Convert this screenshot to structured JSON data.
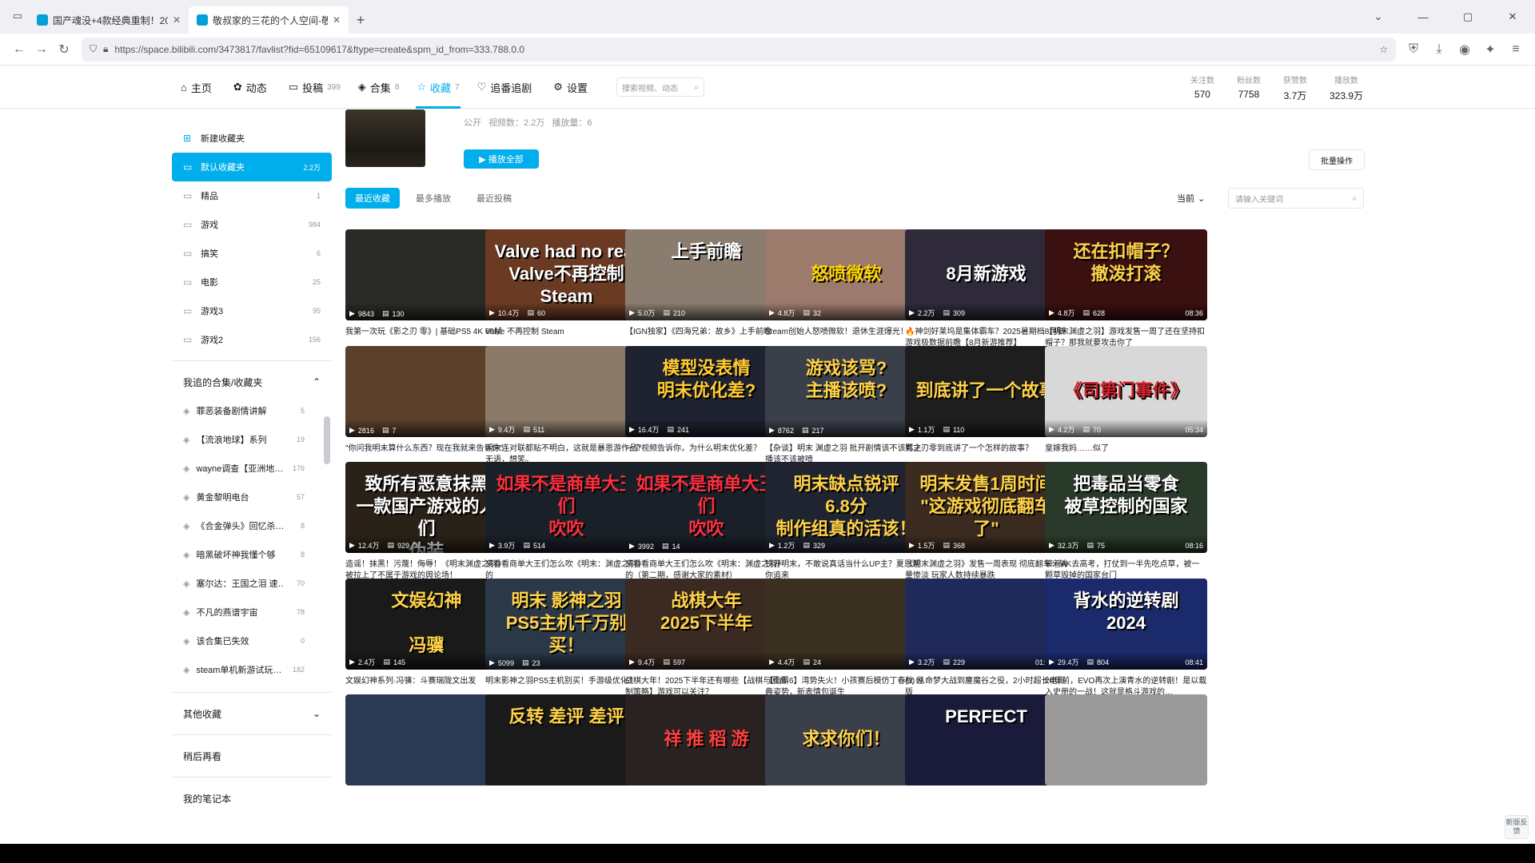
{
  "browser": {
    "tabs": [
      {
        "title": "国产魂没+4款经典重制！2025"
      },
      {
        "title": "敬叔家的三花的个人空间-敬叔"
      }
    ],
    "url": "https://space.bilibili.com/3473817/favlist?fid=65109617&ftype=create&spm_id_from=333.788.0.0"
  },
  "nav": {
    "items": [
      {
        "icon": "⌂",
        "label": "主页",
        "count": ""
      },
      {
        "icon": "✿",
        "label": "动态",
        "count": ""
      },
      {
        "icon": "▭",
        "label": "投稿",
        "count": "399"
      },
      {
        "icon": "◈",
        "label": "合集",
        "count": "8"
      },
      {
        "icon": "☆",
        "label": "收藏",
        "count": "7"
      },
      {
        "icon": "♡",
        "label": "追番追剧",
        "count": ""
      },
      {
        "icon": "⚙",
        "label": "设置",
        "count": ""
      }
    ],
    "search_placeholder": "搜索视频、动态",
    "stats": [
      {
        "label": "关注数",
        "value": "570"
      },
      {
        "label": "粉丝数",
        "value": "7758"
      },
      {
        "label": "获赞数",
        "value": "3.7万"
      },
      {
        "label": "播放数",
        "value": "323.9万"
      }
    ]
  },
  "sidebar": {
    "new_folder": "新建收藏夹",
    "folders": [
      {
        "label": "默认收藏夹",
        "count": "2.2万"
      },
      {
        "label": "精品",
        "count": "1"
      },
      {
        "label": "游戏",
        "count": "984"
      },
      {
        "label": "搞笑",
        "count": "6"
      },
      {
        "label": "电影",
        "count": "25"
      },
      {
        "label": "游戏3",
        "count": "95"
      },
      {
        "label": "游戏2",
        "count": "156"
      }
    ],
    "followed_head": "我追的合集/收藏夹",
    "followed": [
      {
        "label": "罪恶装备剧情讲解",
        "count": "5"
      },
      {
        "label": "【流浪地球】系列",
        "count": "19"
      },
      {
        "label": "wayne调查【亚洲地…",
        "count": "176"
      },
      {
        "label": "黄金黎明电台",
        "count": "57"
      },
      {
        "label": "《合金弹头》回忆杀…",
        "count": "8"
      },
      {
        "label": "暗黑破坏神我懂个够",
        "count": "8"
      },
      {
        "label": "塞尔达：王国之泪 速…",
        "count": "70"
      },
      {
        "label": "不凡的燕谱宇宙",
        "count": "78"
      },
      {
        "label": "该合集已失效",
        "count": "0"
      },
      {
        "label": "steam单机新游试玩…",
        "count": "182"
      }
    ],
    "other": "其他收藏",
    "later": "稍后再看",
    "notes": "我的笔记本"
  },
  "folder": {
    "title_partial": "默认收藏夹",
    "meta": [
      "公开",
      "视频数：2.2万",
      "播放量：6"
    ],
    "play_all": "▶ 播放全部",
    "batch": "批量操作",
    "sorts": [
      "最近收藏",
      "最多播放",
      "最近投稿"
    ],
    "scope": "当前",
    "search_placeholder": "请输入关键词"
  },
  "videos": [
    {
      "title": "我第一次玩《影之刃 零》| 基础PS5 4K 60帧",
      "up": "Gamebreakergod",
      "time": "收藏于1分钟前",
      "views": "9843",
      "danmaku": "130",
      "dur": "56:48",
      "bg": "#2a2a26",
      "txt": "",
      "tc": "#fff"
    },
    {
      "title": "Valve 不再控制 Steam",
      "up": "游戏天业之城",
      "time": "收藏于23分钟前",
      "views": "10.4万",
      "danmaku": "60",
      "dur": "21:56",
      "bg": "#6a3a22",
      "txt": "Valve had no real\nValve不再控制 Steam",
      "tc": "#fff"
    },
    {
      "title": "【IGN独家】《四海兄弟：故乡》上手前瞻",
      "up": "IGN中国",
      "time": "收藏于24分钟前",
      "views": "5.0万",
      "danmaku": "210",
      "dur": "09:50",
      "bg": "#8a7d70",
      "txt": "上手前瞻",
      "tc": "#fff"
    },
    {
      "title": "Steam创始人怒喷微软！退休生涯爆光！",
      "up": "电动小鼠",
      "time": "收藏于28分钟前",
      "views": "4.8万",
      "danmaku": "32",
      "dur": "02:30",
      "bg": "#9c7a6c",
      "txt": "\n怒喷微软",
      "tc": "#ffd700"
    },
    {
      "title": "🔥神剑好莱坞是集体霸车？2025暑期档8月新游戏极数据前瞻【8月新游推荐】",
      "up": "Herb阿",
      "time": "收藏于1小时前",
      "views": "2.2万",
      "danmaku": "309",
      "dur": "16:29",
      "bg": "#2e2a3a",
      "txt": "\n8月新游戏",
      "tc": "#fff"
    },
    {
      "title": "【明末渊虚之羽】游戏发售一周了还在坚持扣帽子？那我就要攻击你了",
      "up": "Hermit攻",
      "time": "收藏于1小时前",
      "views": "4.8万",
      "danmaku": "628",
      "dur": "08:36",
      "bg": "#3a1010",
      "txt": "还在扣帽子？\n撤泼打滚",
      "tc": "#ffd24a"
    },
    {
      "title": "\"你问我明末算什么东西？现在我就来告诉你\"",
      "up": "狐影提",
      "time": "收藏于2小时前",
      "views": "2816",
      "danmaku": "7",
      "dur": "01:03",
      "bg": "#5a3f2a",
      "txt": "",
      "tc": "#fff"
    },
    {
      "title": "明末连对联都贴不明白，这就是暴恩游作品？无语，想笑。",
      "up": "s1eepymoon",
      "time": "收藏于2小时前",
      "views": "9.4万",
      "danmaku": "511",
      "dur": "04:03",
      "bg": "#8a7a68",
      "txt": "",
      "tc": "#fff"
    },
    {
      "title": "一个视频告诉你，为什么明末优化差？",
      "up": "阿黄玩游戏",
      "time": "收藏于3小时前",
      "views": "16.4万",
      "danmaku": "241",
      "dur": "01:54",
      "bg": "#1f2230",
      "txt": "模型没表情\n明末优化差?",
      "tc": "#ffcc33"
    },
    {
      "title": "【杂谈】明末 渊虚之羽 批开剧情该不该骂主播该不该被喷",
      "up": "杰克聊游戏",
      "time": "收藏于3小时前",
      "views": "8762",
      "danmaku": "217",
      "dur": "09:35",
      "bg": "#3a3f4a",
      "txt": "游戏该骂?\n主播该喷?",
      "tc": "#ffd24a"
    },
    {
      "title": "影之刃零到底讲了一个怎样的故事？",
      "up": "玩玩玩游戏",
      "time": "收藏于8小时前",
      "views": "1.1万",
      "danmaku": "110",
      "dur": "17:37",
      "bg": "#1e1e1e",
      "txt": "\n到底讲了一个故事",
      "tc": "#ffd24a"
    },
    {
      "title": "皇嫁我妈……似了",
      "up": "钢铁BigTree",
      "time": "收藏于8小时前",
      "views": "4.2万",
      "danmaku": "70",
      "dur": "05:34",
      "bg": "#d8d8d8",
      "txt": "\n《司第门事件》",
      "tc": "#d0202a"
    },
    {
      "title": "造谣！抹黑！污蔑！侮辱！《明末渊虚之羽》被拉上了不属于游戏的舆论场！",
      "up": "中年玩家张小咸",
      "time": "收藏于9小时前",
      "views": "12.4万",
      "danmaku": "929",
      "dur": "11:27",
      "bg": "#2a2218",
      "txt": "致所有恶意抹黑\n一款国产游戏的人们\n伪装",
      "tc": "#fff"
    },
    {
      "title": "来看看商单大王们怎么吹《明末：渊虚之羽》的",
      "up": "三次元吐槽君",
      "time": "收藏于10小时前",
      "views": "3.9万",
      "danmaku": "514",
      "dur": "13:08",
      "bg": "#1a2028",
      "txt": "如果不是商单大王们\n吹吹",
      "tc": "#ff3040"
    },
    {
      "title": "来看看商单大王们怎么吹《明末：渊虚之羽》的（第二期，感谢大家的素材）",
      "up": "三次元吐槽君",
      "time": "收藏于10小时前",
      "views": "3992",
      "danmaku": "14",
      "dur": "11:01",
      "bg": "#1a2028",
      "txt": "如果不是商单大王们\n吹吹",
      "tc": "#ff3040"
    },
    {
      "title": "锐评明末，不敢说真话当什么UP主？夏恩游你追来",
      "up": "马打权御鲸",
      "time": "收藏于10小时前",
      "views": "1.2万",
      "danmaku": "329",
      "dur": "20:49",
      "bg": "#1f2430",
      "txt": "明末缺点锐评\n6.8分\n制作组真的活该！",
      "tc": "#ffd24a"
    },
    {
      "title": "《明末渊虚之羽》发售一周表现 彻底翻车：销量惨淡 玩家人数持续暴跌",
      "up": "泰曼爱玩游戏",
      "time": "收藏于12小时前",
      "views": "1.5万",
      "danmaku": "368",
      "dur": "02:41",
      "bg": "#3a2a20",
      "txt": "明末发售1周时间\n\"这游戏彻底翻车了\"",
      "tc": "#ffd24a"
    },
    {
      "title": "带着AK去高考，打仗到一半先吃点草，被一颗草毁掉的国家台门",
      "up": "知世君",
      "time": "收藏于12小时前",
      "views": "32.3万",
      "danmaku": "75",
      "dur": "08:16",
      "bg": "#2a3a2a",
      "txt": "把毒品当零食\n被草控制的国家",
      "tc": "#fff"
    },
    {
      "title": "文娱幻神系列·冯骥：斗赛瑞陇文出发",
      "up": "胖也好好",
      "time": "收藏于13小时前",
      "views": "2.4万",
      "danmaku": "145",
      "dur": "21:04",
      "bg": "#1a1a1a",
      "txt": "文娱幻神\n\n冯骥",
      "tc": "#ffd24a"
    },
    {
      "title": "明末影神之羽PS5主机别买！手游级优化？",
      "up": "野豚农旺TV-PS5pro",
      "time": "收藏于14小时前",
      "views": "5099",
      "danmaku": "23",
      "dur": "03:36",
      "bg": "#2a3848",
      "txt": "明末 影神之羽\nPS5主机千万别买！",
      "tc": "#ffd24a"
    },
    {
      "title": "战棋大年！2025下半年还有哪些【战棋与回合制策略】游戏可以关注？",
      "up": "会合罗萨",
      "time": "收藏于14小时前",
      "views": "9.4万",
      "danmaku": "597",
      "dur": "18:21",
      "bg": "#3a2a22",
      "txt": "战棋大年\n2025下半年",
      "tc": "#ffd24a"
    },
    {
      "title": "【街霸6】湾势失火！小孩赛后模仿丁春秋 经典姿势，新表情包诞生",
      "up": "廉洁老登瓜瓜瓜",
      "time": "收藏于14小时前",
      "views": "4.4万",
      "danmaku": "24",
      "dur": "02:52",
      "bg": "#3a3020",
      "txt": "",
      "tc": "#fff"
    },
    {
      "title": "(3) 从命梦大战到鏖魔谷之役，2小时超长电影版",
      "up": "是奕的小小虚弧",
      "time": "收藏于15小时前",
      "views": "3.2万",
      "danmaku": "229",
      "dur": "01:49:45",
      "bg": "#202a5a",
      "txt": "",
      "tc": "#fff"
    },
    {
      "title": "20年前，EVO再次上演青水的逆转剧！是以载入史册的一战！这就是格斗游戏的…",
      "up": "大玩家阿崔",
      "time": "收藏于16小时前",
      "views": "29.4万",
      "danmaku": "804",
      "dur": "08:41",
      "bg": "#1a2a6a",
      "txt": "背水的逆转剧\n2024",
      "tc": "#fff"
    },
    {
      "title": "",
      "up": "",
      "time": "",
      "views": "",
      "danmaku": "",
      "dur": "",
      "bg": "#2a3a55",
      "txt": "",
      "tc": "#fff"
    },
    {
      "title": "",
      "up": "",
      "time": "",
      "views": "",
      "danmaku": "",
      "dur": "",
      "bg": "#1a1a1a",
      "txt": "反转 差评 差评",
      "tc": "#ffd24a"
    },
    {
      "title": "",
      "up": "",
      "time": "",
      "views": "",
      "danmaku": "",
      "dur": "",
      "bg": "#2a2220",
      "txt": "\n祥 推 稻 游",
      "tc": "#ff4040"
    },
    {
      "title": "",
      "up": "",
      "time": "",
      "views": "",
      "danmaku": "",
      "dur": "",
      "bg": "#3a3f4a",
      "txt": "\n求求你们！",
      "tc": "#ffd24a"
    },
    {
      "title": "",
      "up": "",
      "time": "",
      "views": "",
      "danmaku": "",
      "dur": "",
      "bg": "#1a1a3a",
      "txt": "PERFECT",
      "tc": "#fff"
    },
    {
      "title": "",
      "up": "",
      "time": "",
      "views": "",
      "danmaku": "",
      "dur": "",
      "bg": "#9a9a9a",
      "txt": "",
      "tc": "#fff"
    }
  ],
  "side_badge": "新版反馈"
}
